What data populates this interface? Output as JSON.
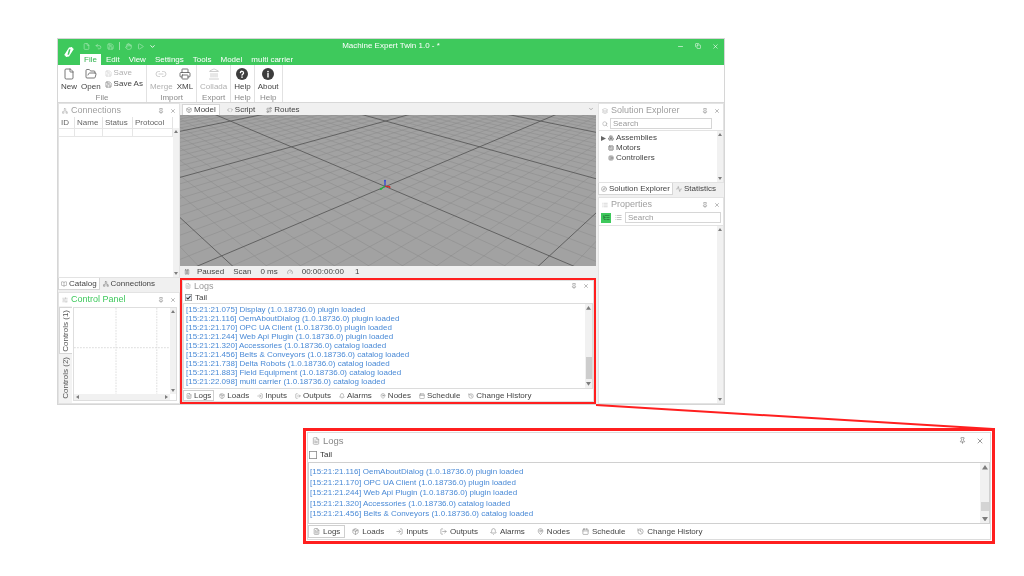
{
  "window": {
    "title": "Machine Expert Twin 1.0 - *"
  },
  "ribbon_tabs": [
    {
      "label": "File",
      "selected": true
    },
    {
      "label": "Edit",
      "selected": false
    },
    {
      "label": "View",
      "selected": false
    },
    {
      "label": "Settings",
      "selected": false
    },
    {
      "label": "Tools",
      "selected": false
    },
    {
      "label": "Model",
      "selected": false
    },
    {
      "label": "multi carrier",
      "selected": false
    }
  ],
  "ribbon_groups": [
    {
      "label": "File",
      "buttons": [
        {
          "label": "New",
          "kind": "large",
          "disabled": false
        },
        {
          "label": "Open",
          "kind": "large",
          "disabled": false
        },
        {
          "label": "Save",
          "kind": "small",
          "disabled": true
        },
        {
          "label": "Save As",
          "kind": "small",
          "disabled": false
        }
      ]
    },
    {
      "label": "Import",
      "buttons": [
        {
          "label": "Merge",
          "kind": "large",
          "disabled": true
        },
        {
          "label": "XML",
          "kind": "large",
          "disabled": false
        }
      ]
    },
    {
      "label": "Export",
      "buttons": [
        {
          "label": "Collada",
          "kind": "large",
          "disabled": true
        }
      ]
    },
    {
      "label": "Help",
      "buttons": [
        {
          "label": "Help",
          "kind": "large",
          "disabled": false
        }
      ]
    },
    {
      "label": "Help",
      "buttons": [
        {
          "label": "About",
          "kind": "large",
          "disabled": false
        }
      ]
    }
  ],
  "connections": {
    "title": "Connections",
    "columns": [
      "ID",
      "Name",
      "Status",
      "Protocol"
    ]
  },
  "left_tabs": [
    {
      "label": "Catalog",
      "selected": true
    },
    {
      "label": "Connections",
      "selected": false
    }
  ],
  "control_panel": {
    "title": "Control Panel",
    "tabs": [
      {
        "label": "Controls (1)",
        "selected": true
      },
      {
        "label": "Controls (2)",
        "selected": false
      }
    ]
  },
  "document_tabs": [
    {
      "label": "Model",
      "selected": true
    },
    {
      "label": "Script",
      "selected": false
    },
    {
      "label": "Routes",
      "selected": false
    }
  ],
  "status_bar": {
    "state": "Paused",
    "scan_label": "Scan",
    "scan_value": "0 ms",
    "time": "00:00:00:00",
    "count": "1"
  },
  "logs": {
    "title": "Logs",
    "tail": {
      "label": "Tail",
      "checked": true
    },
    "entries": [
      "[15:21:21.075] Display (1.0.18736.0) plugin loaded",
      "[15:21:21.116] OemAboutDialog (1.0.18736.0) plugin loaded",
      "[15:21:21.170] OPC UA Client (1.0.18736.0) plugin loaded",
      "[15:21:21.244] Web Api Plugin (1.0.18736.0) plugin loaded",
      "[15:21:21.320] Accessories (1.0.18736.0) catalog loaded",
      "[15:21:21.456] Belts & Conveyors (1.0.18736.0) catalog loaded",
      "[15:21:21.738] Delta Robots (1.0.18736.0) catalog loaded",
      "[15:21:21.883] Field Equipment (1.0.18736.0) catalog loaded",
      "[15:21:22.098] multi carrier (1.0.18736.0) catalog loaded"
    ],
    "tabs": [
      {
        "label": "Logs",
        "selected": true
      },
      {
        "label": "Loads",
        "selected": false
      },
      {
        "label": "Inputs",
        "selected": false
      },
      {
        "label": "Outputs",
        "selected": false
      },
      {
        "label": "Alarms",
        "selected": false
      },
      {
        "label": "Nodes",
        "selected": false
      },
      {
        "label": "Schedule",
        "selected": false
      },
      {
        "label": "Change History",
        "selected": false
      }
    ]
  },
  "solution_explorer": {
    "title": "Solution Explorer",
    "search": {
      "placeholder": "Search"
    },
    "tree": [
      {
        "label": "Assemblies",
        "expanded": false
      },
      {
        "label": "Motors"
      },
      {
        "label": "Controllers"
      }
    ],
    "tabs": [
      {
        "label": "Solution Explorer",
        "selected": true
      },
      {
        "label": "Statistics",
        "selected": false
      }
    ]
  },
  "properties": {
    "title": "Properties",
    "view_modes": [
      {
        "selected": true
      },
      {
        "selected": false
      }
    ],
    "search": {
      "placeholder": "Search"
    }
  },
  "callout": {
    "title": "Logs",
    "tail": {
      "label": "Tail",
      "checked": false
    },
    "entries": [
      "[15:21:21.116] OemAboutDialog (1.0.18736.0) plugin loaded",
      "[15:21:21.170] OPC UA Client (1.0.18736.0) plugin loaded",
      "[15:21:21.244] Web Api Plugin (1.0.18736.0) plugin loaded",
      "[15:21:21.320] Accessories (1.0.18736.0) catalog loaded",
      "[15:21:21.456] Belts & Conveyors (1.0.18736.0) catalog loaded"
    ],
    "tabs": [
      {
        "label": "Logs",
        "selected": true
      },
      {
        "label": "Loads",
        "selected": false
      },
      {
        "label": "Inputs",
        "selected": false
      },
      {
        "label": "Outputs",
        "selected": false
      },
      {
        "label": "Alarms",
        "selected": false
      },
      {
        "label": "Nodes",
        "selected": false
      },
      {
        "label": "Schedule",
        "selected": false
      },
      {
        "label": "Change History",
        "selected": false
      }
    ]
  }
}
